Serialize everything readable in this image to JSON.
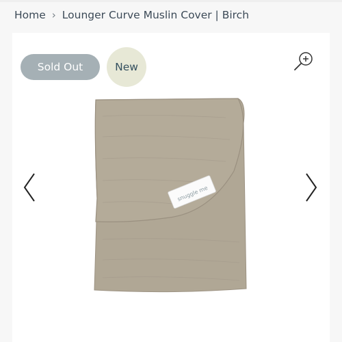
{
  "breadcrumb": {
    "home": "Home",
    "separator": "›",
    "current": "Lounger Curve Muslin Cover | Birch"
  },
  "badges": {
    "sold_out": "Sold Out",
    "new": "New"
  },
  "product_image": {
    "label_brand": "snuggle me",
    "fabric_color": "#b0a795",
    "fabric_shade": "#a2988a"
  },
  "icons": {
    "zoom": "zoom-in-icon",
    "prev": "chevron-left-icon",
    "next": "chevron-right-icon"
  },
  "colors": {
    "breadcrumb_text": "#3c4a57",
    "sold_out_bg": "#a5b0b5",
    "new_bg": "#e7e8d6",
    "new_text": "#34505f"
  }
}
